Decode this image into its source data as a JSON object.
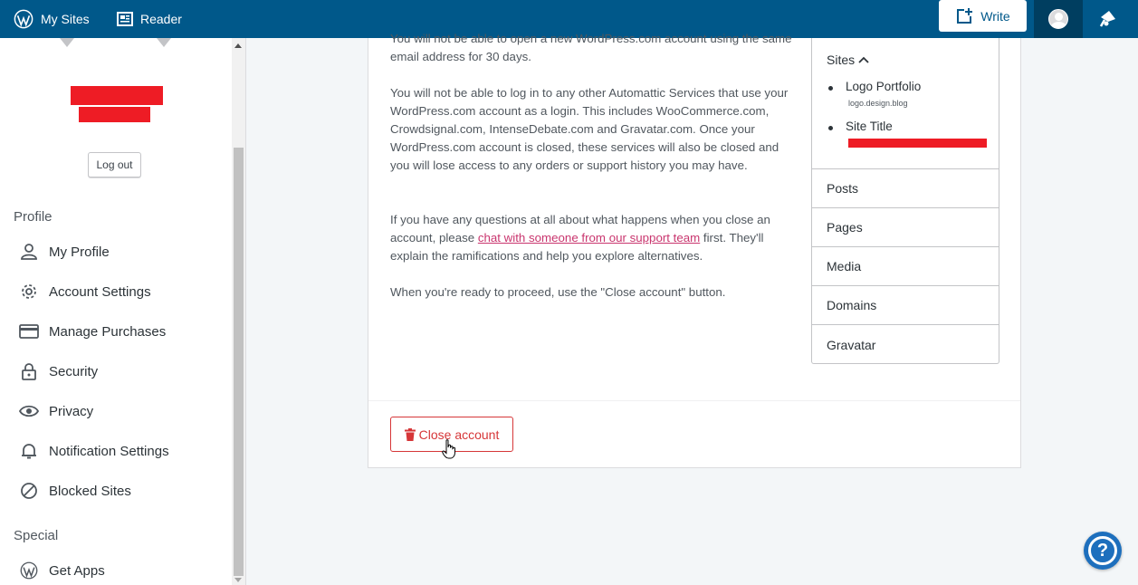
{
  "masterbar": {
    "my_sites": "My Sites",
    "reader": "Reader",
    "write": "Write",
    "icons": [
      "wordpress-icon",
      "reader-icon",
      "write-icon",
      "avatar",
      "notifications-icon"
    ]
  },
  "sidebar": {
    "logout": "Log out",
    "profile_heading": "Profile",
    "items": [
      {
        "label": "My Profile",
        "icon": "person-icon"
      },
      {
        "label": "Account Settings",
        "icon": "gear-icon"
      },
      {
        "label": "Manage Purchases",
        "icon": "credit-card-icon"
      },
      {
        "label": "Security",
        "icon": "lock-icon"
      },
      {
        "label": "Privacy",
        "icon": "eye-icon"
      },
      {
        "label": "Notification Settings",
        "icon": "bell-icon"
      },
      {
        "label": "Blocked Sites",
        "icon": "blocked-icon"
      }
    ],
    "special_heading": "Special",
    "special_items": [
      {
        "label": "Get Apps",
        "icon": "wordpress-icon"
      }
    ]
  },
  "main": {
    "para_top": "You will not be able to open a new WordPress.com account using the same email address for 30 days.",
    "para_services": "You will not be able to log in to any other Automattic Services that use your WordPress.com account as a login. This includes WooCommerce.com, Crowdsignal.com, IntenseDebate.com and Gravatar.com. Once your WordPress.com account is closed, these services will also be closed and you will lose access to any orders or support history you may have.",
    "para_questions_before": "If you have any questions at all about what happens when you close an account, please ",
    "para_questions_link": "chat with someone from our support team",
    "para_questions_after": " first. They'll explain the ramifications and help you explore alternatives.",
    "para_ready": "When you're ready to proceed, use the \"Close account\" button.",
    "close_button": "Close account"
  },
  "services": {
    "sites_heading": "Sites",
    "sites": [
      {
        "name": "Logo Portfolio",
        "url": "logo.design.blog"
      },
      {
        "name": "Site Title",
        "url": ""
      }
    ],
    "rows": [
      "Posts",
      "Pages",
      "Media",
      "Domains",
      "Gravatar"
    ]
  },
  "colors": {
    "masterbar": "#00588a",
    "danger": "#d63638",
    "link": "#c9356e",
    "redaction": "#ee1c25"
  }
}
